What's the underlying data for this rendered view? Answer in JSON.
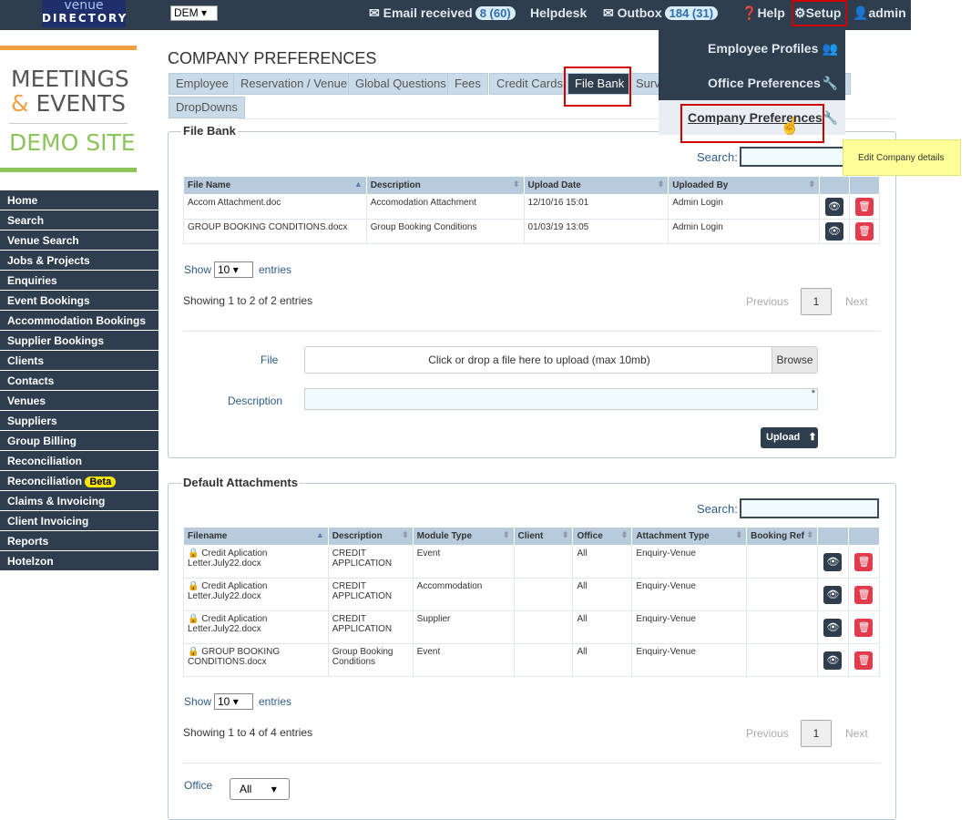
{
  "topbar": {
    "logo_top": "venue",
    "logo_bottom": "DIRECTORY",
    "org_select": "DEM",
    "email": {
      "label": "Email received",
      "badge": "8 (60)"
    },
    "helpdesk": "Helpdesk",
    "outbox": {
      "label": "Outbox",
      "badge": "184 (31)"
    },
    "help": "Help",
    "setup": "Setup",
    "user": "admin"
  },
  "brand": {
    "line1": "MEETINGS",
    "amp": "&",
    "line2": "EVENTS",
    "site": "DEMO SITE"
  },
  "sidebar": {
    "items": [
      "Home",
      "Search",
      "Venue Search",
      "Jobs & Projects",
      "Enquiries",
      "Event Bookings",
      "Accommodation Bookings",
      "Supplier Bookings",
      "Clients",
      "Contacts",
      "Venues",
      "Suppliers",
      "Group Billing",
      "Reconciliation",
      "Reconciliation",
      "Claims & Invoicing",
      "Client Invoicing",
      "Reports",
      "Hotelzon"
    ],
    "beta": "Beta"
  },
  "page": {
    "title": "COMPANY PREFERENCES"
  },
  "tabs": [
    "Employee",
    "Reservation / Venue",
    "Global Questions",
    "Fees",
    "Credit Cards",
    "File Bank",
    "Surv",
    "DropDowns"
  ],
  "setup_menu": {
    "items": [
      "Employee Profiles",
      "Office Preferences",
      "Company Preferences"
    ],
    "tooltip": "Edit Company details"
  },
  "file_bank": {
    "legend": "File Bank",
    "search_label": "Search:",
    "columns": [
      "File Name",
      "Description",
      "Upload Date",
      "Uploaded By"
    ],
    "rows": [
      [
        "Accom Attachment.doc",
        "Accomodation Attachment",
        "12/10/16 15:01",
        "Admin Login"
      ],
      [
        "GROUP BOOKING CONDITIONS.docx",
        "Group Booking Conditions",
        "01/03/19 13:05",
        "Admin Login"
      ]
    ],
    "show_label": "Show",
    "show_value": "10",
    "entries_label": "entries",
    "info": "Showing 1 to 2 of 2 entries",
    "prev": "Previous",
    "page": "1",
    "next": "Next",
    "file_label": "File",
    "dropzone": "Click or drop a file here to upload (max 10mb)",
    "browse": "Browse",
    "desc_label": "Description",
    "required": "*",
    "upload": "Upload"
  },
  "default_attachments": {
    "legend": "Default Attachments",
    "search_label": "Search:",
    "columns": [
      "Filename",
      "Description",
      "Module Type",
      "Client",
      "Office",
      "Attachment Type",
      "Booking Ref"
    ],
    "rows": [
      [
        "Credit Aplication Letter.July22.docx",
        "CREDIT APPLICATION",
        "Event",
        "",
        "All",
        "Enquiry-Venue",
        ""
      ],
      [
        "Credit Aplication Letter.July22.docx",
        "CREDIT APPLICATION",
        "Accommodation",
        "",
        "All",
        "Enquiry-Venue",
        ""
      ],
      [
        "Credit Aplication Letter.July22.docx",
        "CREDIT APPLICATION",
        "Supplier",
        "",
        "All",
        "Enquiry-Venue",
        ""
      ],
      [
        "GROUP BOOKING CONDITIONS.docx",
        "Group Booking Conditions",
        "Event",
        "",
        "All",
        "Enquiry-Venue",
        ""
      ]
    ],
    "show_label": "Show",
    "show_value": "10",
    "entries_label": "entries",
    "info": "Showing 1 to 4 of 4 entries",
    "prev": "Previous",
    "page": "1",
    "next": "Next",
    "office_label": "Office",
    "office_value": "All"
  }
}
